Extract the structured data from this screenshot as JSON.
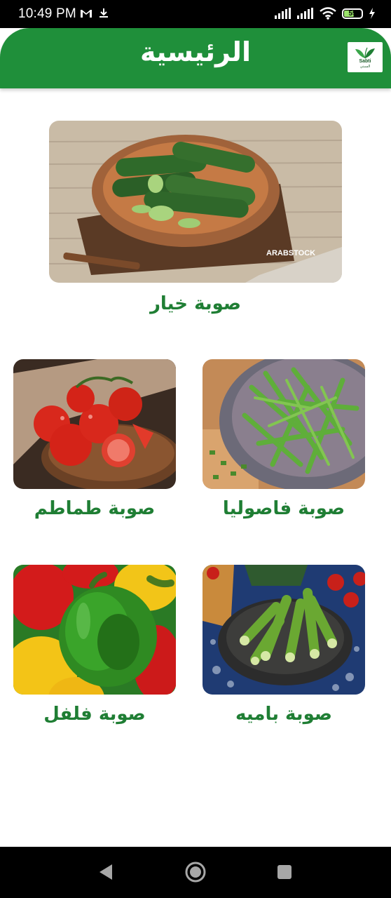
{
  "status_bar": {
    "time": "10:49 PM",
    "battery_level": "59",
    "battery_fraction": 0.59,
    "icons": [
      "gmail-icon",
      "download-icon",
      "signal-icon",
      "signal-icon-2",
      "wifi-icon",
      "battery-icon",
      "charging-icon"
    ]
  },
  "header": {
    "title": "الرئيسية",
    "logo_text": "Sabti",
    "logo_subtext": "السبتي"
  },
  "items": [
    {
      "label": "صوبة خيار",
      "image": "cucumbers-image"
    },
    {
      "label": "صوبة فاصوليا",
      "image": "green-beans-image"
    },
    {
      "label": "صوبة طماطم",
      "image": "tomatoes-image"
    },
    {
      "label": "صوبة باميه",
      "image": "okra-image"
    },
    {
      "label": "صوبة فلفل",
      "image": "peppers-image"
    }
  ],
  "image_watermark": "ARABSTOCK",
  "nav_bar": {
    "buttons": [
      "back-icon",
      "home-icon",
      "recents-icon"
    ]
  },
  "colors": {
    "primary": "#1f8f3a",
    "label_green": "#1f7e34",
    "status_bar": "#000000"
  }
}
